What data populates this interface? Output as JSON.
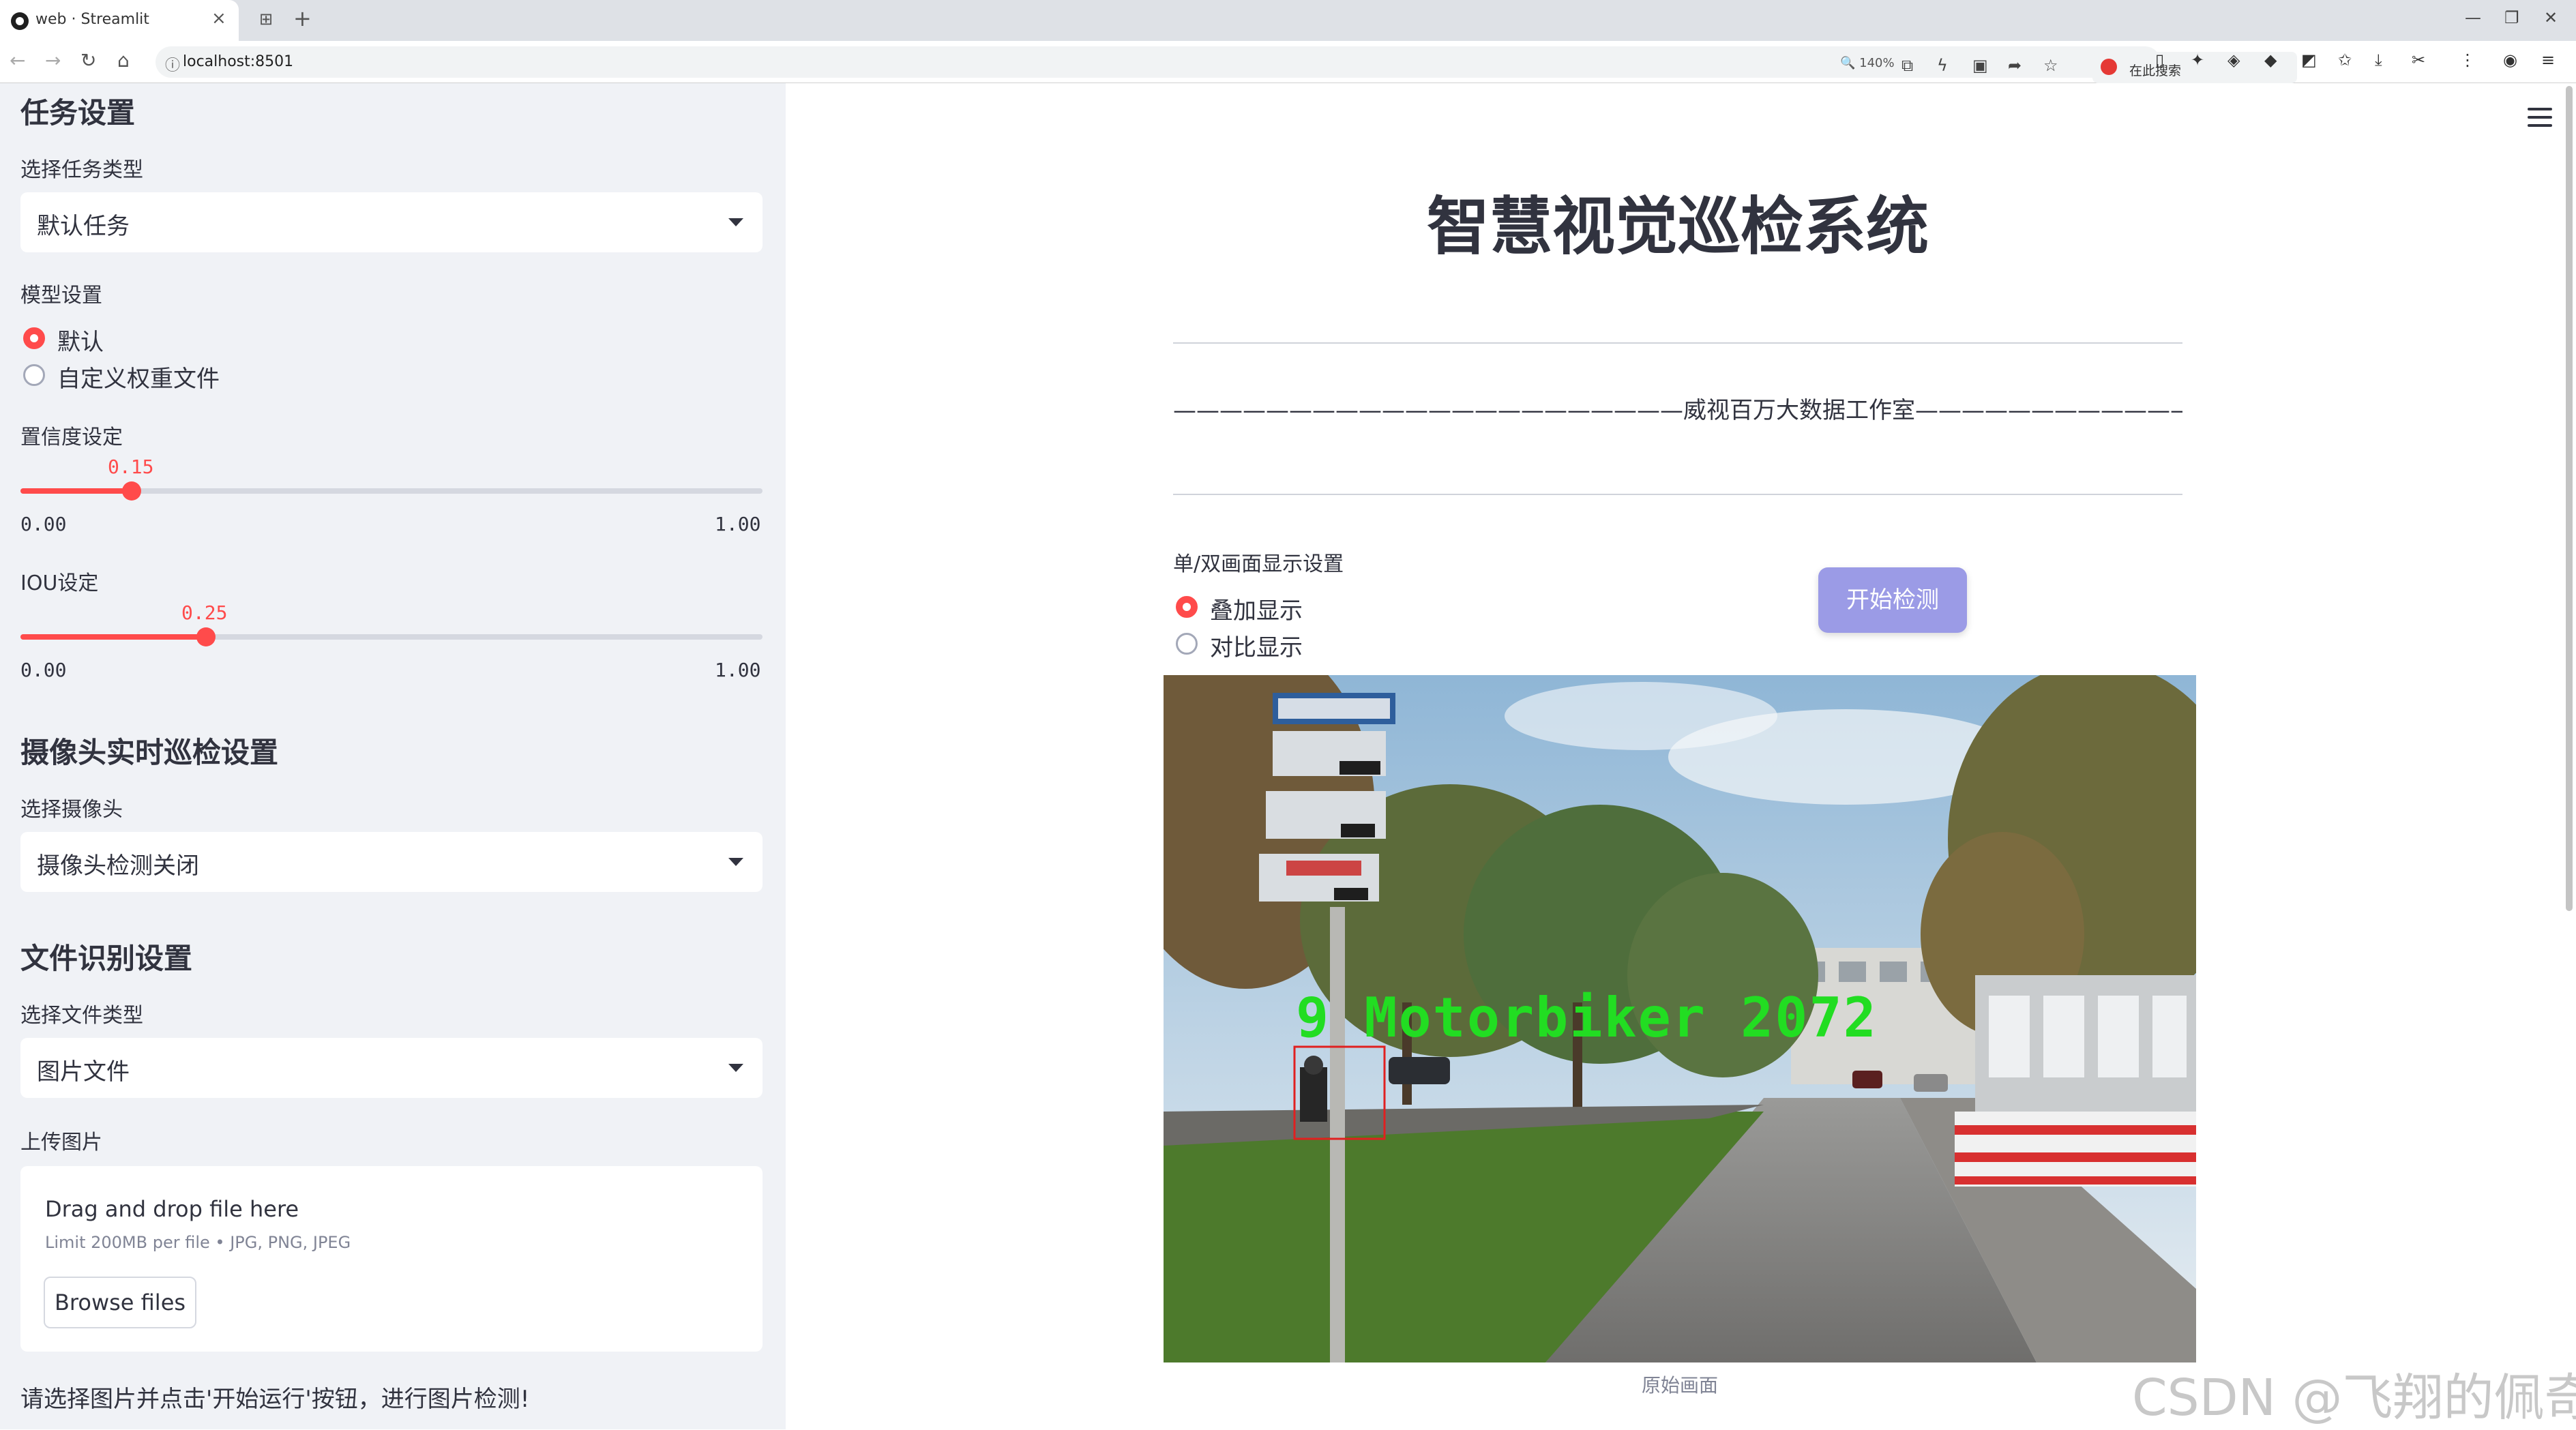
{
  "browser": {
    "tab_title": "web · Streamlit",
    "url": "localhost:8501",
    "zoom": "140%",
    "search_label": "在此搜索"
  },
  "sidebar": {
    "task_section_title": "任务设置",
    "task_type_label": "选择任务类型",
    "task_type_value": "默认任务",
    "model_label": "模型设置",
    "model_options": [
      "默认",
      "自定义权重文件"
    ],
    "model_selected": "默认",
    "conf_label": "置信度设定",
    "conf_value": "0.15",
    "conf_min": "0.00",
    "conf_max": "1.00",
    "conf_fraction": 0.15,
    "iou_label": "IOU设定",
    "iou_value": "0.25",
    "iou_min": "0.00",
    "iou_max": "1.00",
    "iou_fraction": 0.25,
    "camera_section_title": "摄像头实时巡检设置",
    "camera_label": "选择摄像头",
    "camera_value": "摄像头检测关闭",
    "file_section_title": "文件识别设置",
    "file_type_label": "选择文件类型",
    "file_type_value": "图片文件",
    "upload_label": "上传图片",
    "upload_title": "Drag and drop file here",
    "upload_limit": "Limit 200MB per file • JPG, PNG, JPEG",
    "browse_label": "Browse files",
    "hint": "请选择图片并点击'开始运行'按钮，进行图片检测!"
  },
  "main": {
    "title": "智慧视觉巡检系统",
    "studio_line": "——————————————————————威视百万大数据工作室———————————————————————",
    "display_label": "单/双画面显示设置",
    "display_options": [
      "叠加显示",
      "对比显示"
    ],
    "display_selected": "叠加显示",
    "start_button": "开始检测",
    "detection_text": "9  Motorbiker  2072",
    "image_caption": "原始画面"
  },
  "colors": {
    "accent": "#ff4b4b",
    "start_button": "#9b9be6",
    "sidebar_bg": "#f0f2f6",
    "detection_text": "#22dd22",
    "detection_box": "#e02020"
  },
  "icons": {
    "tab": "streamlit-favicon",
    "menu": "hamburger-icon",
    "select": "chevron-down-icon"
  },
  "watermark": "CSDN @飞翔的佩奇"
}
